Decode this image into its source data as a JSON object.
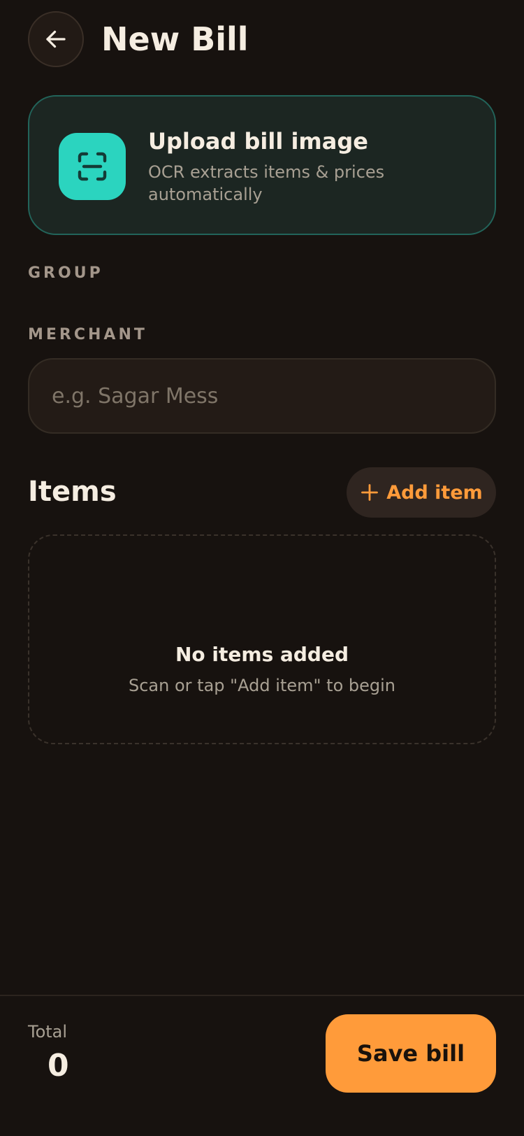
{
  "header": {
    "title": "New Bill",
    "back_icon": "arrow-left-icon"
  },
  "upload": {
    "title": "Upload bill image",
    "subtitle": "OCR extracts items & prices automatically",
    "icon": "scan-icon",
    "accent_color": "#2bd4bf"
  },
  "group": {
    "label": "GROUP"
  },
  "merchant": {
    "label": "MERCHANT",
    "value": "",
    "placeholder": "e.g. Sagar Mess"
  },
  "items": {
    "title": "Items",
    "add_label": "Add item",
    "add_icon": "plus-icon",
    "empty_title": "No items added",
    "empty_subtitle": "Scan or tap \"Add item\" to begin"
  },
  "footer": {
    "total_label": "Total",
    "total_value": "0",
    "save_label": "Save bill",
    "accent_color": "#ff9b3a"
  }
}
